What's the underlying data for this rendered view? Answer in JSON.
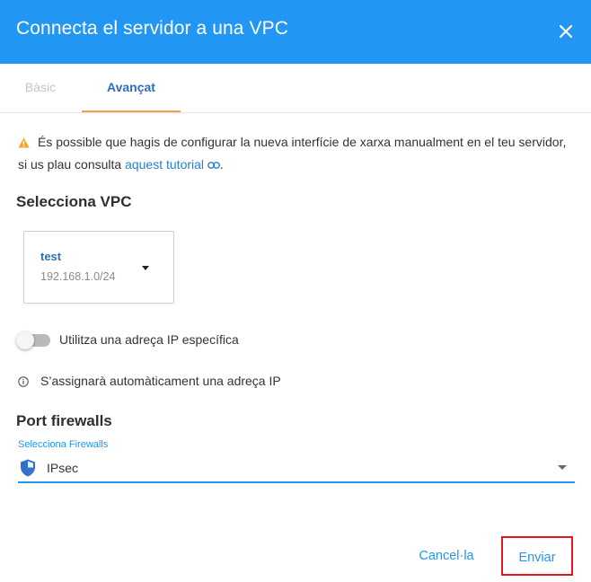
{
  "dialog": {
    "title": "Connecta el servidor a una VPC",
    "close_icon": "close-icon"
  },
  "tabs": [
    {
      "label": "Bàsic",
      "active": false
    },
    {
      "label": "Avançat",
      "active": true
    }
  ],
  "warning": {
    "icon": "warning-icon",
    "text": "És possible que hagis de configurar la nueva interfície de xarxa manualment en el teu servidor, si us plau consulta",
    "link_text": "aquest tutorial",
    "link_icon": "link-icon",
    "trailing": "."
  },
  "vpc_section": {
    "title": "Selecciona VPC",
    "selected": {
      "name": "test",
      "cidr": "192.168.1.0/24"
    }
  },
  "specific_ip": {
    "label": "Utilitza una adreça IP específica",
    "enabled": false
  },
  "auto_ip_info": {
    "icon": "info-icon",
    "text": "S’assignarà automàticament una adreça IP"
  },
  "firewalls": {
    "title": "Port firewalls",
    "field_label": "Selecciona Firewalls",
    "value_icon": "shield-icon",
    "value": "IPsec"
  },
  "actions": {
    "cancel_label": "Cancel·la",
    "submit_label": "Enviar"
  },
  "colors": {
    "header": "#2196f3",
    "accent": "#2196f3",
    "tab_indicator": "#f0a04b",
    "warning": "#f5a623",
    "highlight_border": "#e0191e"
  }
}
